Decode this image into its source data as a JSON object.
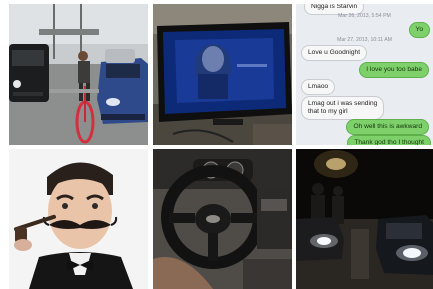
{
  "tiles": [
    {
      "name": "photo-cars-and-cyclist"
    },
    {
      "name": "photo-tv-screen"
    },
    {
      "name": "photo-text-conversation"
    },
    {
      "name": "photo-mustache-man"
    },
    {
      "name": "photo-steering-wheel"
    },
    {
      "name": "photo-night-street"
    }
  ],
  "chat": {
    "top_partial": "Nigga is Starvin",
    "ts1": "Mar 26, 2013, 5:54 PM",
    "msg_yo": "Yo",
    "ts2": "Mar 27, 2013, 10:11 AM",
    "msg_love_goodnight": "Love u Goodnight",
    "msg_love_you_too": "I love you too babe",
    "msg_lmaoo": "Lmaoo",
    "msg_lmag_1": "Lmag out i was sending",
    "msg_lmag_2": "that to my girl",
    "msg_awkward": "Oh well this is awkward",
    "msg_thank_god": "Thank god tho I thought"
  },
  "colors": {
    "out_bubble": "#7ed16a",
    "in_bubble": "#f7f7f7",
    "chat_bg": "#e9edf2"
  }
}
